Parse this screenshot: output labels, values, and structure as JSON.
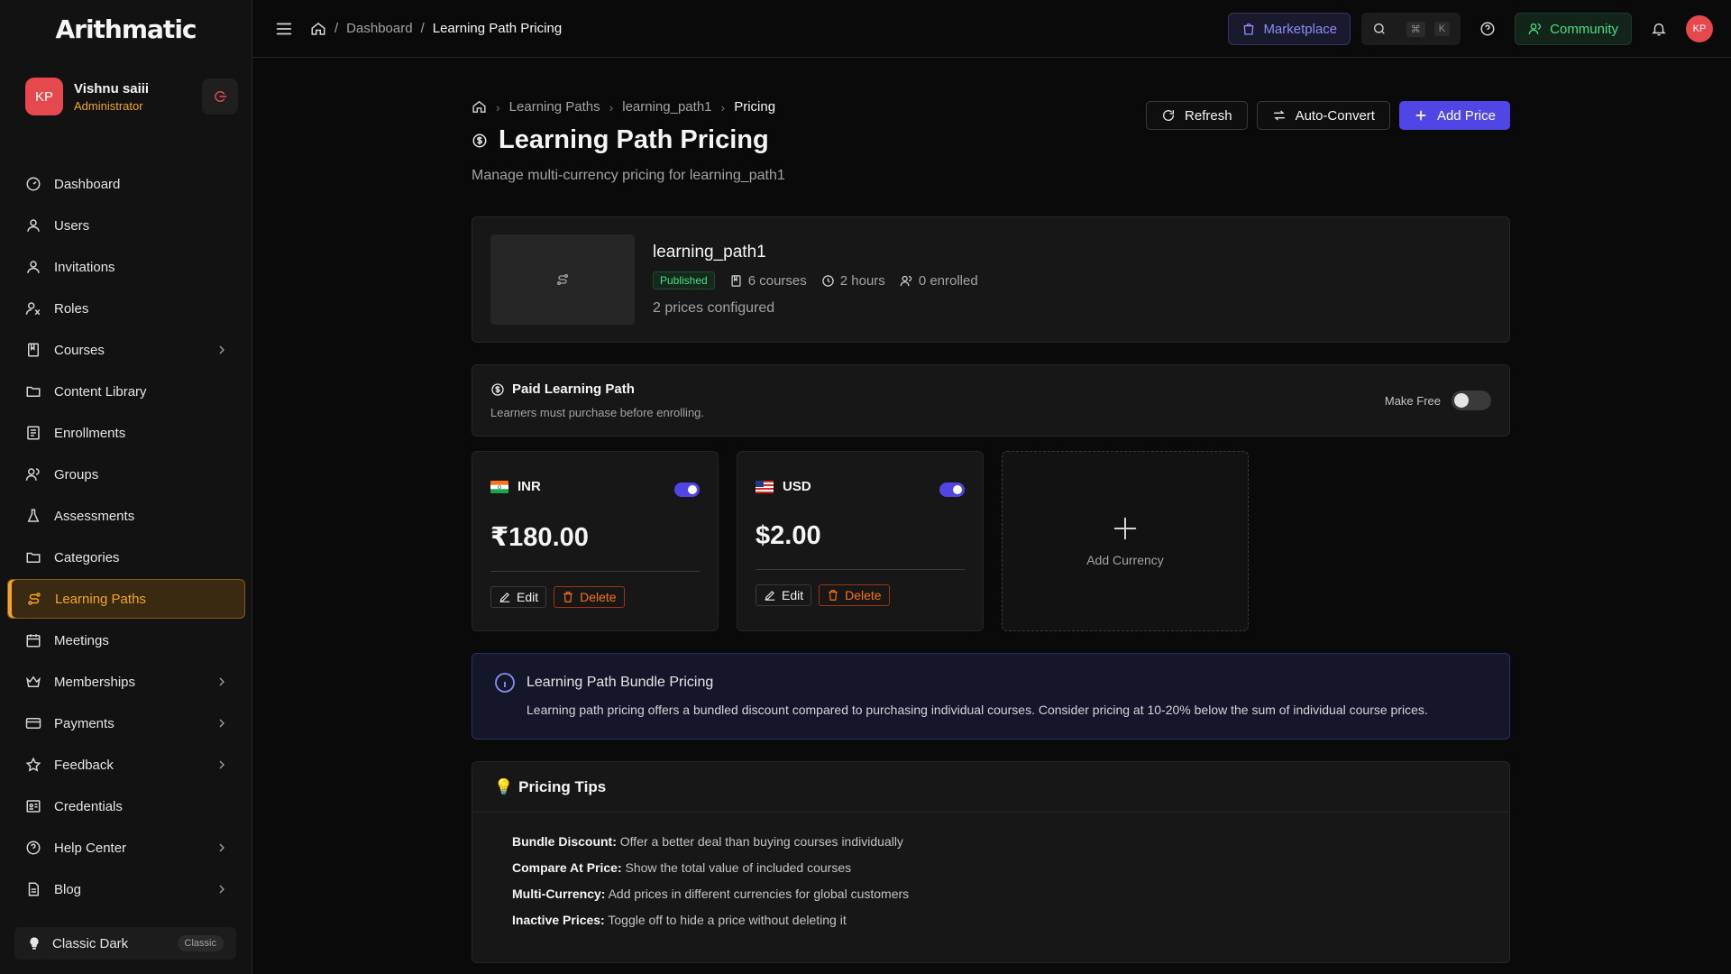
{
  "app": {
    "logo": "Arithmatic"
  },
  "user": {
    "initials": "KP",
    "name": "Vishnu saiii",
    "role": "Administrator"
  },
  "sidebar": {
    "items": [
      {
        "label": "Dashboard",
        "icon": "dashboard-icon"
      },
      {
        "label": "Users",
        "icon": "user-icon"
      },
      {
        "label": "Invitations",
        "icon": "user-icon"
      },
      {
        "label": "Roles",
        "icon": "roles-icon"
      },
      {
        "label": "Courses",
        "icon": "book-icon"
      },
      {
        "label": "Content Library",
        "icon": "folder-icon"
      },
      {
        "label": "Enrollments",
        "icon": "list-icon"
      },
      {
        "label": "Groups",
        "icon": "group-icon"
      },
      {
        "label": "Assessments",
        "icon": "flask-icon"
      },
      {
        "label": "Categories",
        "icon": "folder-icon"
      },
      {
        "label": "Learning Paths",
        "icon": "route-icon"
      },
      {
        "label": "Meetings",
        "icon": "calendar-icon"
      },
      {
        "label": "Memberships",
        "icon": "crown-icon"
      },
      {
        "label": "Payments",
        "icon": "card-icon"
      },
      {
        "label": "Feedback",
        "icon": "star-icon"
      },
      {
        "label": "Credentials",
        "icon": "credential-icon"
      },
      {
        "label": "Help Center",
        "icon": "help-icon"
      },
      {
        "label": "Blog",
        "icon": "document-icon"
      }
    ],
    "theme": {
      "label": "Classic Dark",
      "badge": "Classic"
    }
  },
  "topbar": {
    "breadcrumb": {
      "parent": "Dashboard",
      "current": "Learning Path Pricing"
    },
    "marketplace": "Marketplace",
    "kbd1": "⌘",
    "kbd2": "K",
    "community": "Community",
    "avatar": "KP"
  },
  "page": {
    "breadcrumb": [
      "Learning Paths",
      "learning_path1",
      "Pricing"
    ],
    "title": "Learning Path Pricing",
    "subtitle": "Manage multi-currency pricing for learning_path1",
    "actions": {
      "refresh": "Refresh",
      "auto_convert": "Auto-Convert",
      "add_price": "Add Price"
    }
  },
  "path": {
    "name": "learning_path1",
    "status": "Published",
    "courses": "6 courses",
    "duration": "2 hours",
    "enrolled": "0 enrolled",
    "prices_configured": "2 prices configured"
  },
  "paid": {
    "title": "Paid Learning Path",
    "desc": "Learners must purchase before enrolling.",
    "make_free_label": "Make Free",
    "make_free_on": false
  },
  "prices": [
    {
      "currency": "INR",
      "amount": "₹180.00",
      "active": true,
      "edit": "Edit",
      "delete": "Delete"
    },
    {
      "currency": "USD",
      "amount": "$2.00",
      "active": true,
      "edit": "Edit",
      "delete": "Delete"
    }
  ],
  "add_currency": "Add Currency",
  "bundle": {
    "title": "Learning Path Bundle Pricing",
    "text": "Learning path pricing offers a bundled discount compared to purchasing individual courses. Consider pricing at 10-20% below the sum of individual course prices."
  },
  "tips": {
    "title": "Pricing Tips",
    "items": [
      {
        "label": "Bundle Discount:",
        "text": "Offer a better deal than buying courses individually"
      },
      {
        "label": "Compare At Price:",
        "text": "Show the total value of included courses"
      },
      {
        "label": "Multi-Currency:",
        "text": "Add prices in different currencies for global customers"
      },
      {
        "label": "Inactive Prices:",
        "text": "Toggle off to hide a price without deleting it"
      }
    ]
  },
  "colors": {
    "accent": "#f5a524",
    "primary": "#4f46e5",
    "danger": "#f97316",
    "success": "#4ade80"
  }
}
